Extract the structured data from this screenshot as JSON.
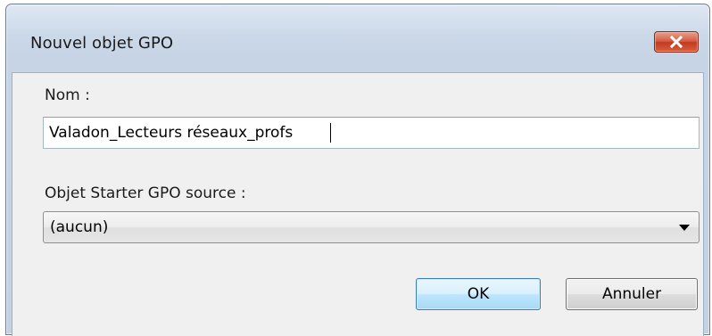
{
  "window": {
    "title": "Nouvel objet GPO",
    "close_icon": "close-x-icon"
  },
  "form": {
    "name_label": "Nom :",
    "name_value": "Valadon_Lecteurs réseaux_profs",
    "starter_label": "Objet Starter GPO source :",
    "starter_selected": "(aucun)",
    "starter_arrow_icon": "dropdown-arrow-icon"
  },
  "buttons": {
    "ok_label": "OK",
    "cancel_label": "Annuler"
  },
  "colors": {
    "close_button": "#c94a2f",
    "ok_button_border": "#3c7fb1",
    "frame": "#c6d4e5"
  }
}
